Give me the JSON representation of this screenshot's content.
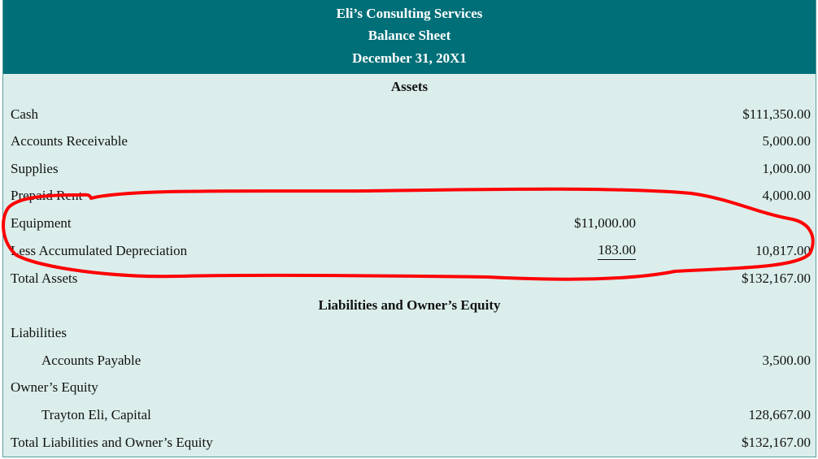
{
  "header": {
    "company": "Eli’s Consulting Services",
    "statement": "Balance Sheet",
    "date": "December 31, 20X1"
  },
  "assets": {
    "heading": "Assets",
    "rows": [
      {
        "label": "Cash",
        "mid": "",
        "amount": "$111,350.00"
      },
      {
        "label": "Accounts Receivable",
        "mid": "",
        "amount": "5,000.00"
      },
      {
        "label": "Supplies",
        "mid": "",
        "amount": "1,000.00"
      },
      {
        "label": "Prepaid Rent",
        "mid": "",
        "amount": "4,000.00"
      },
      {
        "label": "Equipment",
        "mid": "$11,000.00",
        "amount": ""
      },
      {
        "label": "Less Accumulated Depreciation",
        "mid": "183.00",
        "amount": "10,817.00"
      },
      {
        "label": "Total Assets",
        "mid": "",
        "amount": "$132,167.00"
      }
    ]
  },
  "liabilities_equity": {
    "heading": "Liabilities and Owner’s Equity",
    "rows": [
      {
        "label": "Liabilities",
        "amount": ""
      },
      {
        "label": "Accounts Payable",
        "amount": "3,500.00"
      },
      {
        "label": "Owner’s Equity",
        "amount": ""
      },
      {
        "label": "Trayton Eli, Capital",
        "amount": "128,667.00"
      },
      {
        "label": "Total Liabilities and Owner’s Equity",
        "amount": "$132,167.00"
      }
    ]
  },
  "annotation": {
    "color": "#ff0000"
  }
}
